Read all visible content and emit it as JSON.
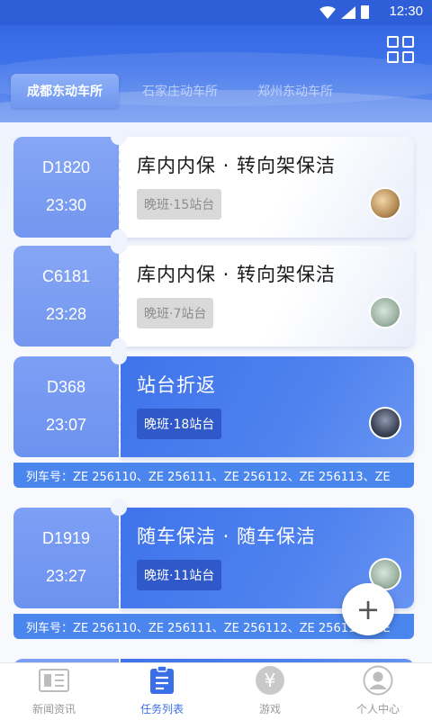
{
  "status": {
    "time": "12:30"
  },
  "header": {
    "tabs": [
      {
        "label": "成都东动车所",
        "active": true
      },
      {
        "label": "石家庄动车所",
        "active": false
      },
      {
        "label": "郑州东动车所",
        "active": false
      }
    ]
  },
  "tasks": [
    {
      "train": "D1820",
      "time": "23:30",
      "title": "库内内保 · 转向架保洁",
      "tag": "晚班·15站台",
      "style": "white"
    },
    {
      "train": "C6181",
      "time": "23:28",
      "title": "库内内保 · 转向架保洁",
      "tag": "晚班·7站台",
      "style": "white"
    },
    {
      "train": "D368",
      "time": "23:07",
      "title": "站台折返",
      "tag": "晚班·18站台",
      "style": "blue",
      "trains_label": "列车号：",
      "trains": "ZE 256110、ZE 256111、ZE 256112、ZE 256113、ZE"
    },
    {
      "train": "D1919",
      "time": "23:27",
      "title": "随车保洁 · 随车保洁",
      "tag": "晚班·11站台",
      "style": "blue",
      "trains_label": "列车号：",
      "trains": "ZE 256110、ZE 256111、ZE 256112、ZE 256113、ZE"
    }
  ],
  "fab": {
    "icon": "plus-icon",
    "symbol": "+"
  },
  "nav": [
    {
      "label": "新闻资讯",
      "icon": "news-icon",
      "active": false
    },
    {
      "label": "任务列表",
      "icon": "task-list-icon",
      "active": true
    },
    {
      "label": "游戏",
      "icon": "yen-coin-icon",
      "active": false
    },
    {
      "label": "个人中心",
      "icon": "user-icon",
      "active": false
    }
  ],
  "colors": {
    "primary": "#3b6fe8",
    "ticket_left": "#7397ef",
    "tag_dark": "#2f58c9"
  }
}
